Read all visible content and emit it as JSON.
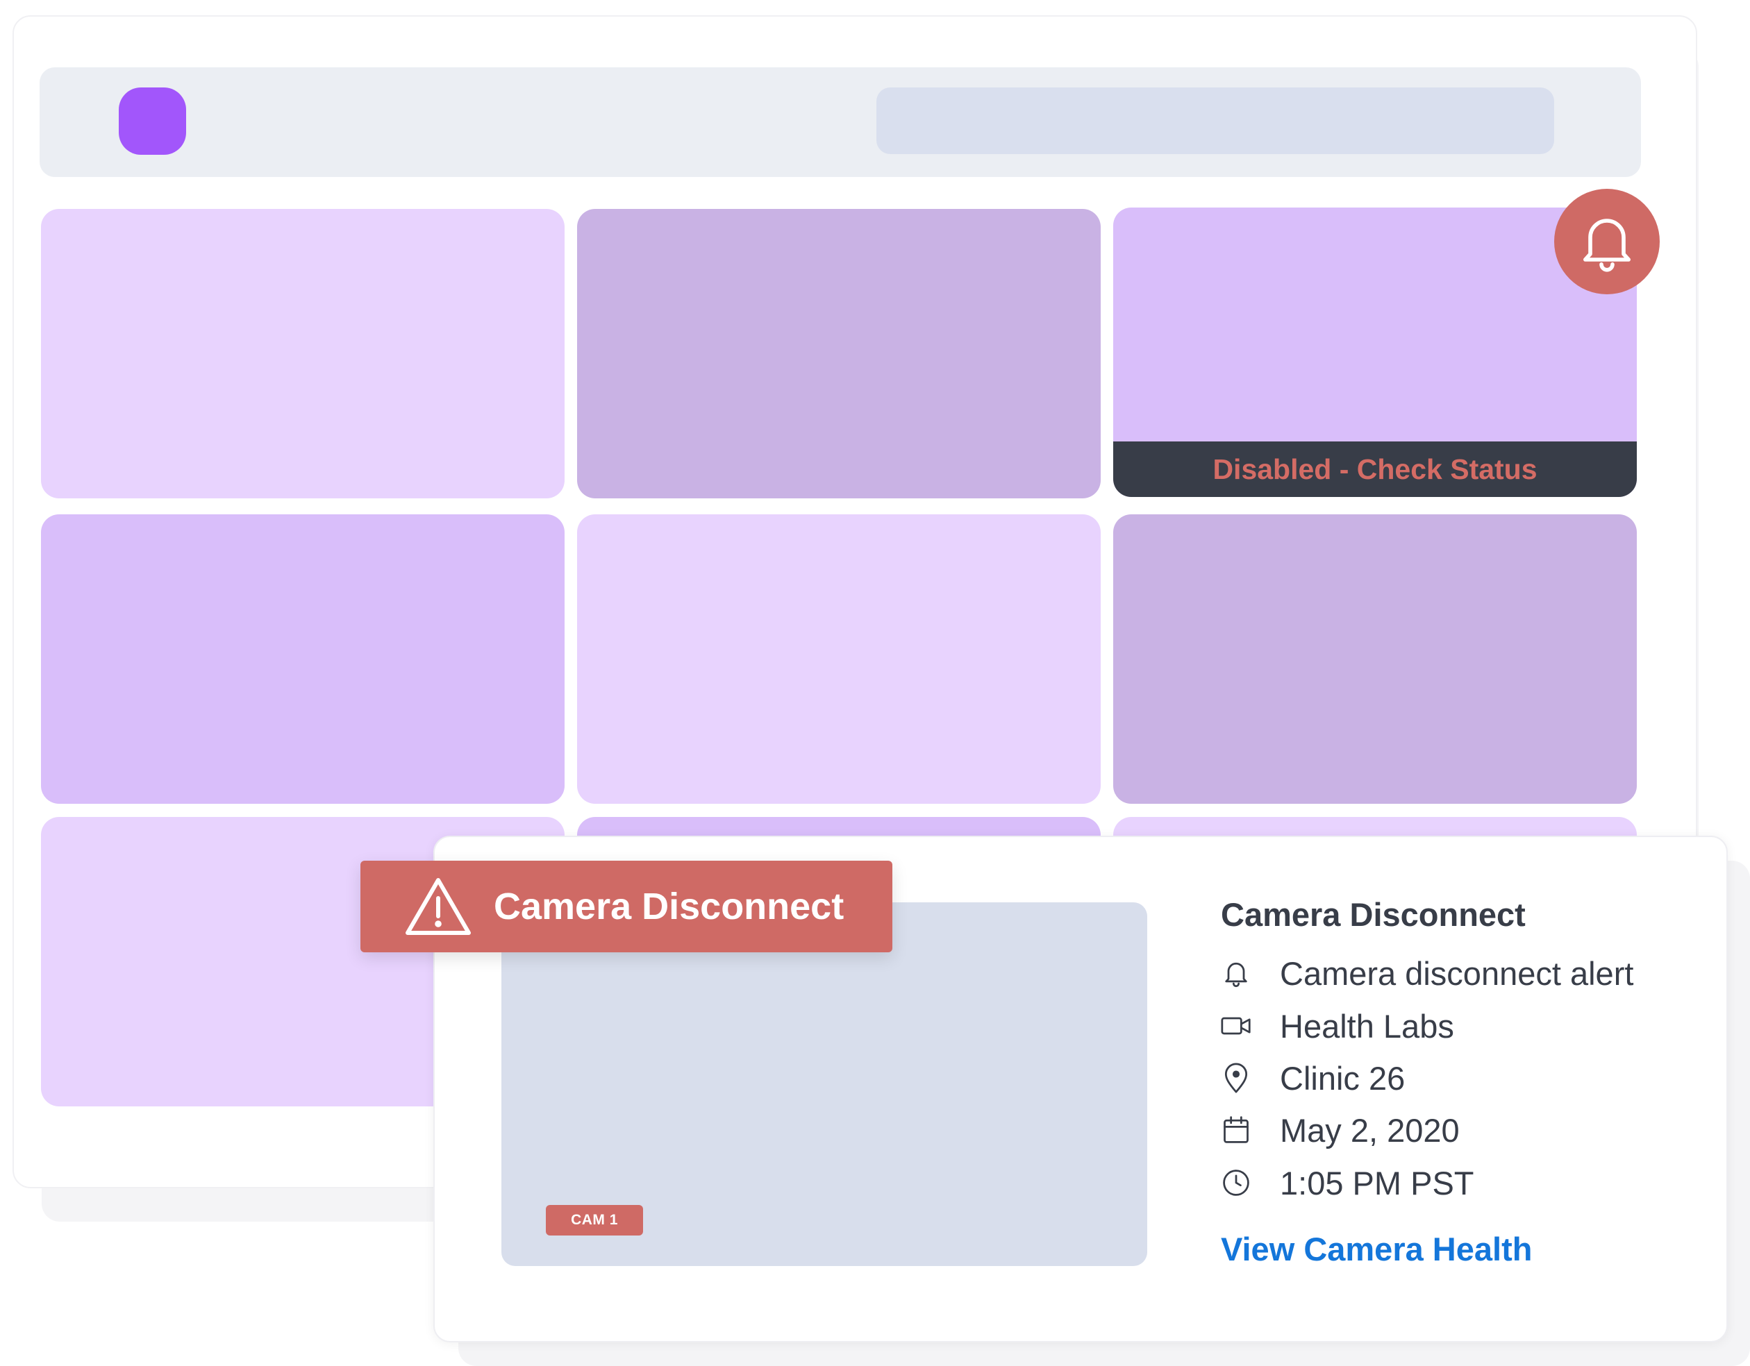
{
  "dashboard": {
    "tile_status": "Disabled - Check Status",
    "alert_icon": "bell-icon"
  },
  "alert": {
    "banner_title": "Camera Disconnect",
    "banner_icon": "warning-icon",
    "camera_tag": "CAM 1",
    "details": {
      "title": "Camera Disconnect",
      "alert_type": "Camera disconnect alert",
      "camera_group": "Health Labs",
      "location": "Clinic 26",
      "date": "May 2, 2020",
      "time": "1:05 PM PST"
    },
    "view_link": "View Camera Health"
  },
  "colors": {
    "brand": "#a256fb",
    "alert": "#cf6a65",
    "link": "#1476da",
    "text": "#383d48"
  }
}
